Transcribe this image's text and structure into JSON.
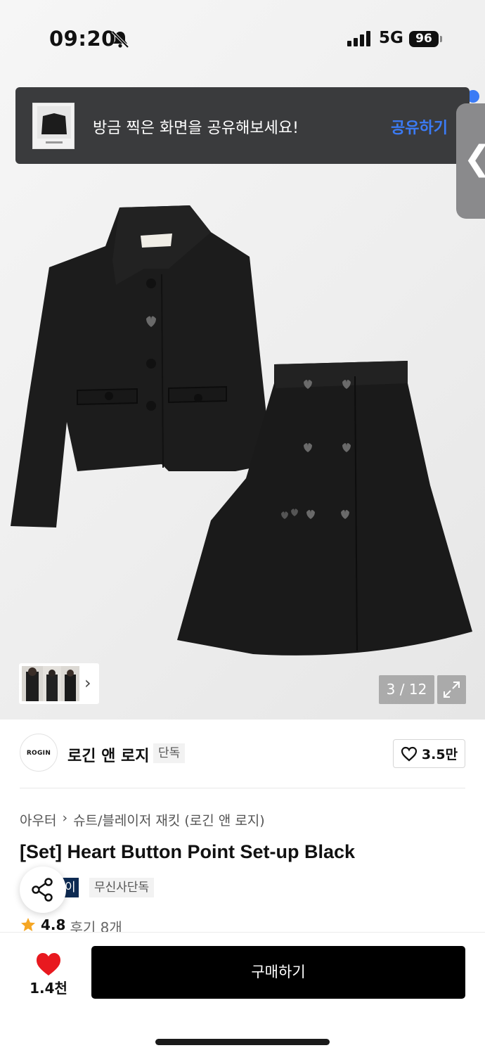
{
  "status_bar": {
    "time": "09:20",
    "network": "5G",
    "battery": "96"
  },
  "share_banner": {
    "message": "방금 찍은 화면을 공유해보세요!",
    "action": "공유하기",
    "action_color": "#3b7bf5"
  },
  "side_handle": {
    "glyph": "❮"
  },
  "gallery": {
    "counter": "3 / 12",
    "thumb_chevron": "›"
  },
  "brand": {
    "logo_text": "ROGIN",
    "name": "로긴 앤 로지",
    "tag": "단독",
    "likes": "3.5만"
  },
  "breadcrumb": {
    "category": "아우터",
    "separator": "›",
    "subcategory": "슈트/블레이저 재킷 (로긴 앤 로지)"
  },
  "product": {
    "title": "[Set] Heart Button Point Set-up Black",
    "badge_dark": "이",
    "badge_light": "무신사단독",
    "rating": "4.8",
    "reviews": "후기 8개"
  },
  "bottom_bar": {
    "heart_count": "1.4천",
    "buy_label": "구매하기",
    "heart_color": "#e8191f"
  }
}
